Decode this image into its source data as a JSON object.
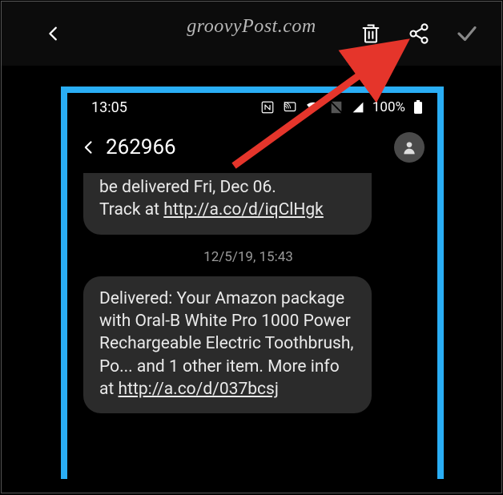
{
  "watermark": "groovyPost.com",
  "topbar": {
    "back_name": "back",
    "delete_name": "delete",
    "share_name": "share",
    "confirm_name": "confirm"
  },
  "status": {
    "time": "13:05",
    "battery_pct": "100%"
  },
  "conversation": {
    "title": "262966",
    "msg1_line1": "be delivered Fri, Dec 06.",
    "msg1_line2a": "Track at ",
    "msg1_link": "http://a.co/d/iqClHgk",
    "timestamp": "12/5/19, 15:43",
    "msg2_text": "Delivered: Your Amazon package with Oral-B White Pro 1000 Power Rechargeable Electric Toothbrush, Po... and 1 other item. More info at ",
    "msg2_link": "http://a.co/d/037bcsj"
  }
}
